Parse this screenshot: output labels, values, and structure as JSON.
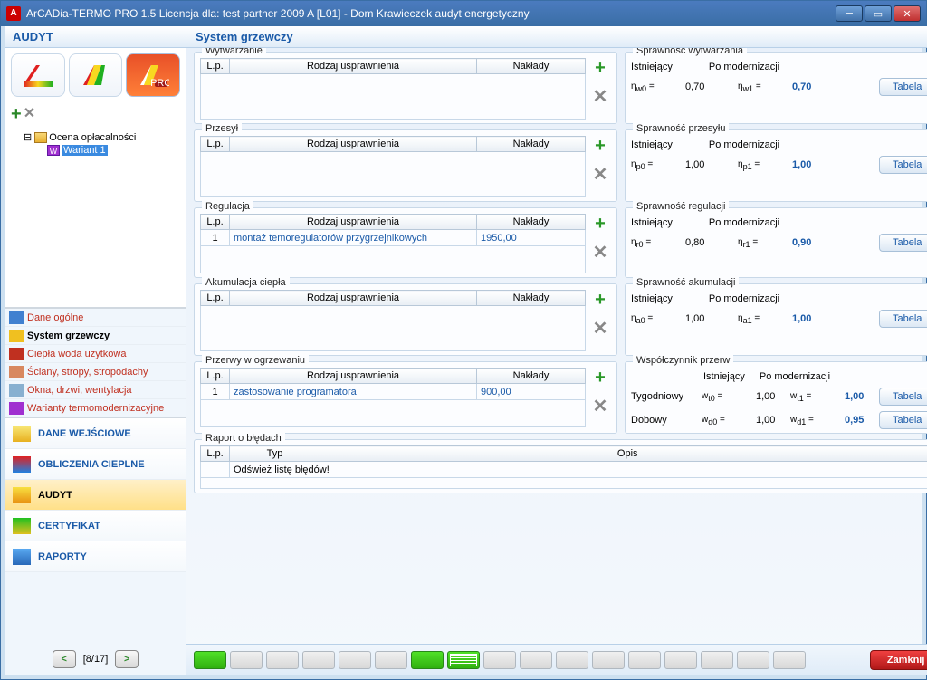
{
  "window": {
    "title": "ArCADia-TERMO PRO 1.5 Licencja dla: test partner 2009 A [L01] - Dom Krawieczek audyt energetyczny"
  },
  "sidebar": {
    "title": "AUDYT",
    "tree": {
      "root": "Ocena opłacalności",
      "child": "Wariant 1"
    },
    "nav": [
      {
        "label": "Dane ogólne"
      },
      {
        "label": "System grzewczy",
        "active": true
      },
      {
        "label": "Ciepła woda użytkowa"
      },
      {
        "label": "Ściany, stropy, stropodachy"
      },
      {
        "label": "Okna, drzwi, wentylacja"
      },
      {
        "label": "Warianty termomodernizacyjne"
      }
    ],
    "bignav": [
      {
        "label": "DANE WEJŚCIOWE"
      },
      {
        "label": "OBLICZENIA CIEPLNE"
      },
      {
        "label": "AUDYT",
        "active": true
      },
      {
        "label": "CERTYFIKAT"
      },
      {
        "label": "RAPORTY"
      }
    ],
    "pager": "[8/17]"
  },
  "main": {
    "title": "System grzewczy",
    "sections": [
      {
        "legend": "Wytwarzanie",
        "rows": []
      },
      {
        "legend": "Przesył",
        "rows": []
      },
      {
        "legend": "Regulacja",
        "rows": [
          {
            "lp": "1",
            "rodzaj": "montaż temoregulatorów przygrzejnikowych",
            "naklady": "1950,00"
          }
        ]
      },
      {
        "legend": "Akumulacja ciepła",
        "rows": []
      },
      {
        "legend": "Przerwy w ogrzewaniu",
        "rows": [
          {
            "lp": "1",
            "rodzaj": "zastosowanie programatora",
            "naklady": "900,00"
          }
        ]
      }
    ],
    "headers": {
      "lp": "L.p.",
      "rodzaj": "Rodzaj usprawnienia",
      "naklady": "Nakłady"
    },
    "efficiency": [
      {
        "legend": "Sprawność wytwarzania",
        "head1": "Istniejący",
        "head2": "Po modernizacji",
        "s0": "ηw0",
        "v0": "0,70",
        "s1": "ηw1",
        "v1": "0,70",
        "btn": "Tabela"
      },
      {
        "legend": "Sprawność przesyłu",
        "head1": "Istniejący",
        "head2": "Po modernizacji",
        "s0": "ηp0",
        "v0": "1,00",
        "s1": "ηp1",
        "v1": "1,00",
        "btn": "Tabela"
      },
      {
        "legend": "Sprawność regulacji",
        "head1": "Istniejący",
        "head2": "Po modernizacji",
        "s0": "ηr0",
        "v0": "0,80",
        "s1": "ηr1",
        "v1": "0,90",
        "btn": "Tabela"
      },
      {
        "legend": "Sprawność akumulacji",
        "head1": "Istniejący",
        "head2": "Po modernizacji",
        "s0": "ηa0",
        "v0": "1,00",
        "s1": "ηa1",
        "v1": "1,00",
        "btn": "Tabela"
      }
    ],
    "breaks": {
      "legend": "Współczynnik przerw",
      "head1": "Istniejący",
      "head2": "Po modernizacji",
      "rows": [
        {
          "label": "Tygodniowy",
          "s0": "wt0",
          "v0": "1,00",
          "s1": "wt1",
          "v1": "1,00",
          "btn": "Tabela"
        },
        {
          "label": "Dobowy",
          "s0": "wd0",
          "v0": "1,00",
          "s1": "wd1",
          "v1": "0,95",
          "btn": "Tabela"
        }
      ]
    },
    "errors": {
      "legend": "Raport o błędach",
      "h_lp": "L.p.",
      "h_typ": "Typ",
      "h_opis": "Opis",
      "msg": "Odśwież listę błędów!"
    }
  },
  "footer": {
    "close": "Zamknij"
  }
}
